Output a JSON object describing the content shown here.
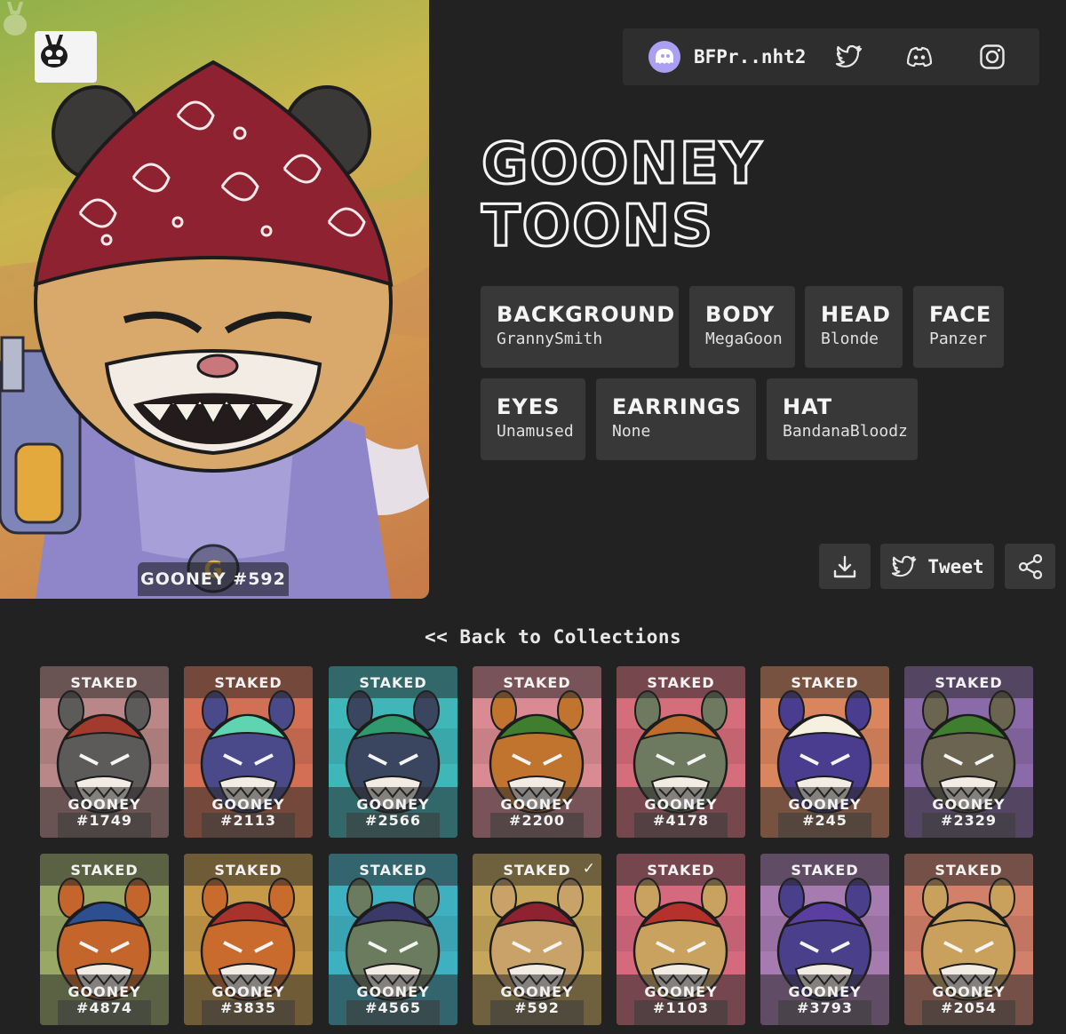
{
  "hero": {
    "caption": "GOONEY #592"
  },
  "wallet": {
    "address": "BFPr..nht2"
  },
  "social": {
    "items": [
      "twitter-icon",
      "discord-icon",
      "instagram-icon"
    ]
  },
  "title": {
    "line1": "GOONEY",
    "line2": "TOONS"
  },
  "traits": [
    {
      "name": "BACKGROUND",
      "value": "GrannySmith"
    },
    {
      "name": "BODY",
      "value": "MegaGoon"
    },
    {
      "name": "HEAD",
      "value": "Blonde"
    },
    {
      "name": "FACE",
      "value": "Panzer"
    },
    {
      "name": "EYES",
      "value": "Unamused"
    },
    {
      "name": "EARRINGS",
      "value": "None"
    },
    {
      "name": "HAT",
      "value": "BandanaBloodz"
    }
  ],
  "actions": {
    "download_icon": "download-icon",
    "tweet_label": "Tweet",
    "share_icon": "share-icon"
  },
  "collection": {
    "back_label": "<< Back to Collections",
    "staked_label": "STAKED",
    "name_prefix": "GOONEY",
    "cards": [
      {
        "number": "#1749",
        "bg": "#b98787",
        "fur": "#5d5a5a",
        "hat": "#a33a2e",
        "selected": false
      },
      {
        "number": "#2113",
        "bg": "#d26f55",
        "fur": "#4a4a8a",
        "hat": "#5fd4b0",
        "selected": false
      },
      {
        "number": "#2566",
        "bg": "#3fb7b9",
        "fur": "#3a4560",
        "hat": "#2e9a6e",
        "selected": false
      },
      {
        "number": "#2200",
        "bg": "#d98a92",
        "fur": "#c0742e",
        "hat": "#3f7d2f",
        "selected": false
      },
      {
        "number": "#4178",
        "bg": "#d56d7b",
        "fur": "#6d7a5f",
        "hat": "#c06a2c",
        "selected": false
      },
      {
        "number": "#245",
        "bg": "#d9865e",
        "fur": "#4a3c8f",
        "hat": "#f5f0e0",
        "selected": false
      },
      {
        "number": "#2329",
        "bg": "#8a6aa8",
        "fur": "#6a6450",
        "hat": "#3f7d2f",
        "selected": false
      },
      {
        "number": "#4874",
        "bg": "#9aa866",
        "fur": "#c4662c",
        "hat": "#2e4f8f",
        "selected": false
      },
      {
        "number": "#3835",
        "bg": "#c79a4a",
        "fur": "#c96b2c",
        "hat": "#a8322c",
        "selected": false
      },
      {
        "number": "#4565",
        "bg": "#3fb0c0",
        "fur": "#6b7b5e",
        "hat": "#3a3a6a",
        "selected": false
      },
      {
        "number": "#592",
        "bg": "#c6a65a",
        "fur": "#c8a268",
        "hat": "#8e2231",
        "selected": true
      },
      {
        "number": "#1103",
        "bg": "#d56a7e",
        "fur": "#c8a25e",
        "hat": "#b5322c",
        "selected": false
      },
      {
        "number": "#3793",
        "bg": "#a57bb0",
        "fur": "#4a3f8a",
        "hat": "#5a3fa0",
        "selected": false
      },
      {
        "number": "#2054",
        "bg": "#d3806a",
        "fur": "#c9a05c",
        "hat": "#c9a05c",
        "selected": false
      }
    ],
    "checkmark": "✓"
  }
}
